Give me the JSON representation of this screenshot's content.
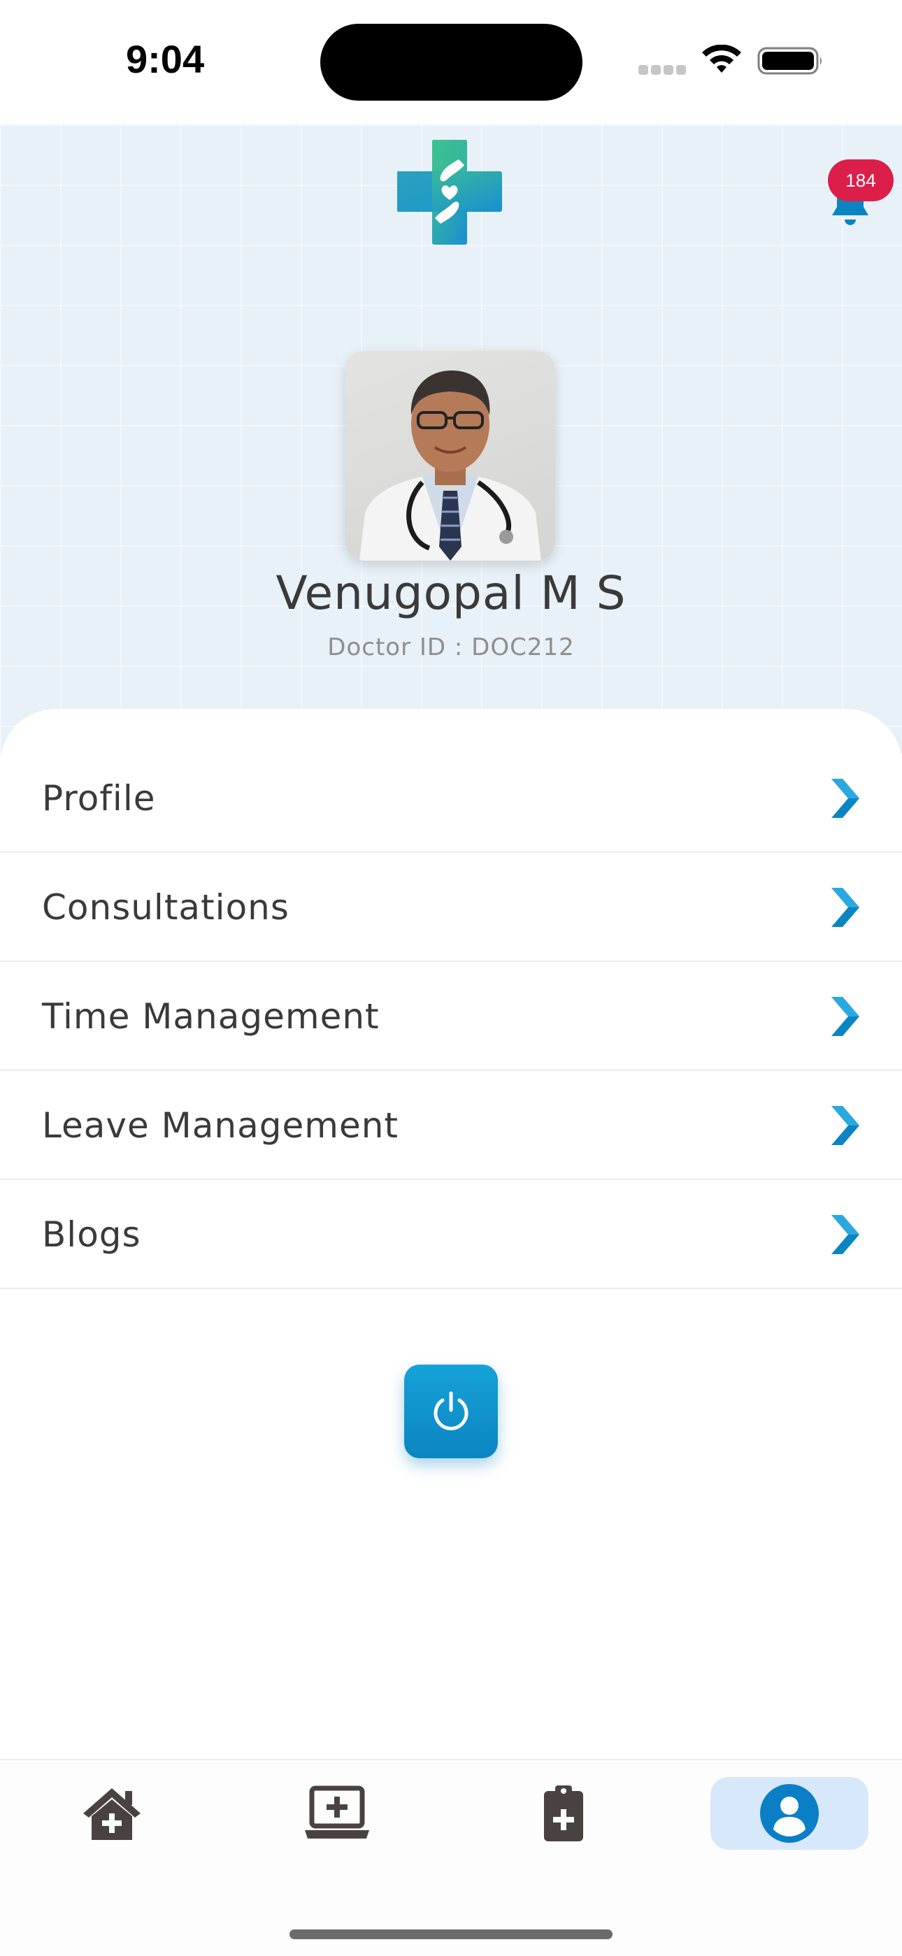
{
  "status_bar": {
    "time": "9:04"
  },
  "header": {
    "logo_icon": "medical-cross-heart-hands-icon",
    "notification_icon": "bell-icon",
    "notification_count": "184"
  },
  "profile": {
    "avatar_icon": "doctor-photo",
    "name": "Venugopal M S",
    "doctor_id": "Doctor ID : DOC212"
  },
  "menu": {
    "items": [
      {
        "label": "Profile"
      },
      {
        "label": "Consultations"
      },
      {
        "label": "Time Management"
      },
      {
        "label": "Leave Management"
      },
      {
        "label": "Blogs"
      }
    ],
    "chevron_icon": "chevron-right-icon"
  },
  "logout": {
    "icon": "power-icon"
  },
  "tab_bar": {
    "tabs": [
      {
        "icon": "home-plus-icon",
        "active": false
      },
      {
        "icon": "laptop-medical-icon",
        "active": false
      },
      {
        "icon": "clipboard-medical-icon",
        "active": false
      },
      {
        "icon": "user-circle-icon",
        "active": true
      }
    ]
  },
  "colors": {
    "accent": "#0b85c2",
    "badge": "#dc1f4a",
    "header_bg": "#e8f1f8",
    "active_tab_bg": "#d7e8fa",
    "text_primary": "#3a3a3a",
    "text_secondary": "#8e8e8e"
  }
}
